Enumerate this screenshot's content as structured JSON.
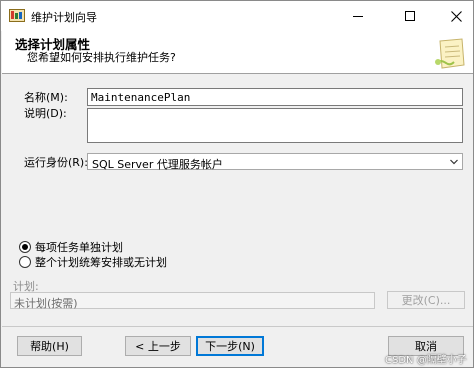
{
  "window": {
    "title": "维护计划向导",
    "header_title": "选择计划属性",
    "header_subtitle": "您希望如何安排执行维护任务?"
  },
  "form": {
    "name_label": "名称(M):",
    "name_value": "MaintenancePlan",
    "desc_label": "说明(D):",
    "desc_value": "",
    "runas_label": "运行身份(R):",
    "runas_value": "SQL Server 代理服务帐户"
  },
  "schedule_options": {
    "option1": "每项任务单独计划",
    "option2": "整个计划统筹安排或无计划",
    "selected": "option1"
  },
  "schedule": {
    "label": "计划:",
    "value": "未计划(按需)",
    "change_button": "更改(C)..."
  },
  "buttons": {
    "help": "帮助(H)",
    "back": "< 上一步",
    "next": "下一步(N)",
    "cancel": "取消"
  },
  "watermark": "CSDN @隔壁小子"
}
